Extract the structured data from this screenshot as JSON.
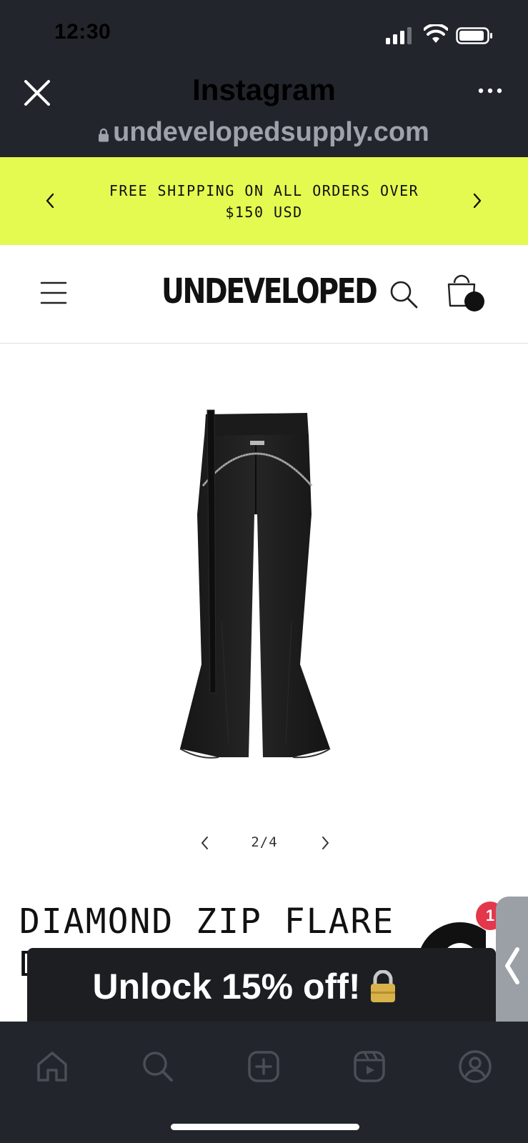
{
  "status_bar": {
    "time": "12:30"
  },
  "browser": {
    "title": "Instagram",
    "url": "undevelopedsupply.com"
  },
  "announcement": {
    "line1": "FREE SHIPPING ON ALL ORDERS OVER",
    "line2": "$150 USD",
    "background": "#e4fa50"
  },
  "site": {
    "logo": "UNDEVELOPED"
  },
  "gallery": {
    "counter": "2/4"
  },
  "product": {
    "title_line1": "DIAMOND ZIP FLARE",
    "title_line2": "D"
  },
  "chat": {
    "badge_count": "1"
  },
  "promo": {
    "text": "Unlock 15% off!"
  },
  "bottom_nav": {
    "items": [
      "home-icon",
      "search-icon",
      "create-icon",
      "reels-icon",
      "profile-icon"
    ]
  },
  "colors": {
    "chrome": "#22252b",
    "accent": "#e4fa50",
    "badge": "#e3384b"
  }
}
